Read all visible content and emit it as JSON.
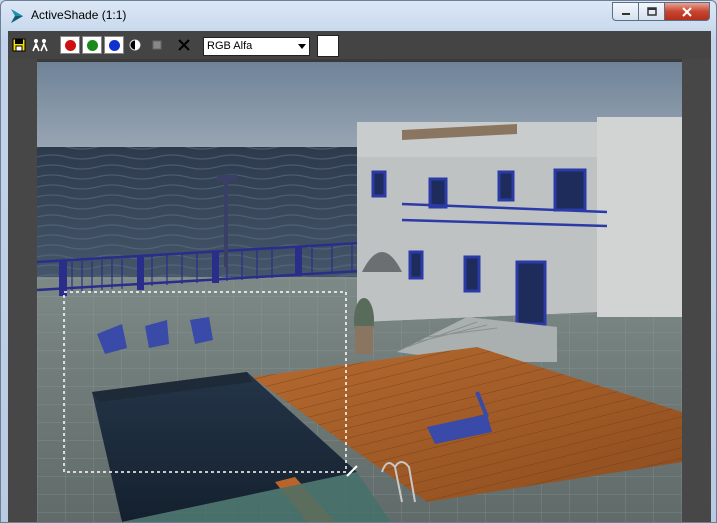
{
  "window": {
    "title": "ActiveShade (1:1)"
  },
  "toolbar": {
    "channel_select": {
      "value": "RGB Alfa"
    },
    "buttons": [
      "save-image",
      "clone-window",
      "red-channel",
      "green-channel",
      "blue-channel",
      "mono-toggle",
      "alpha-toggle",
      "clear"
    ]
  },
  "colors": {
    "red": "#d01010",
    "green": "#1a8a1a",
    "blue": "#1030d0",
    "swatch": "#ffffff"
  }
}
